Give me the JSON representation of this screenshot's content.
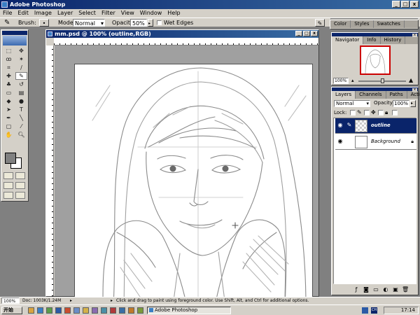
{
  "app": {
    "title": "Adobe Photoshop"
  },
  "menu": [
    "File",
    "Edit",
    "Image",
    "Layer",
    "Select",
    "Filter",
    "View",
    "Window",
    "Help"
  ],
  "options": {
    "brush_label": "Brush:",
    "mode_label": "Mode:",
    "mode_value": "Normal",
    "opacity_label": "Opacity:",
    "opacity_value": "50%",
    "wet_edges_label": "Wet Edges"
  },
  "document": {
    "title": "mm.psd @ 100% (outline,RGB)"
  },
  "top_panel": {
    "tabs": [
      "Color",
      "Styles",
      "Swatches"
    ]
  },
  "navigator": {
    "tabs": [
      "Navigator",
      "Info",
      "History"
    ],
    "zoom": "100%"
  },
  "layers_panel": {
    "tabs": [
      "Layers",
      "Channels",
      "Paths",
      "Actions"
    ],
    "blend_mode": "Normal",
    "opacity_label": "Opacity:",
    "opacity_value": "100%",
    "lock_label": "Lock:",
    "layers": [
      {
        "name": "outline",
        "selected": true
      },
      {
        "name": "Background",
        "selected": false
      }
    ]
  },
  "status": {
    "zoom": "100%",
    "doc_info": "Doc: 1003K/1.24M",
    "hint": "Click and drag to paint using foreground color.  Use Shift, Alt, and Ctrl for additional options."
  },
  "taskbar": {
    "start": "开始",
    "task": "Adobe Photoshop",
    "clock": "17:14"
  },
  "colors": {
    "accent": "#0a246a",
    "chrome": "#d4d0c8",
    "workspace": "#808080"
  }
}
